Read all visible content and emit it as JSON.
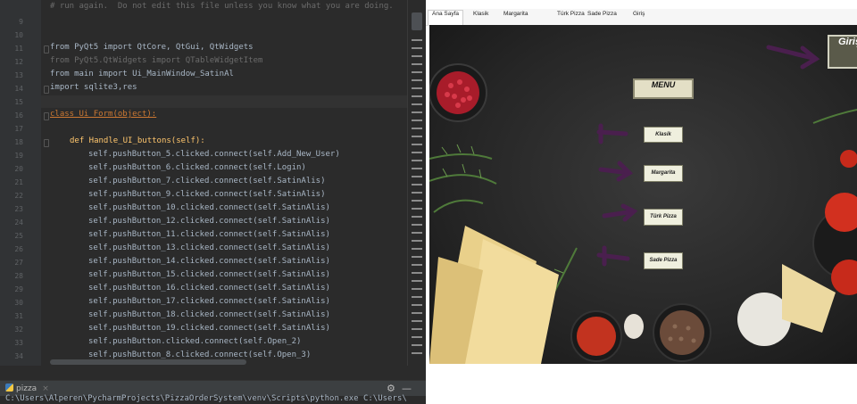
{
  "ide": {
    "top_comment": "# run again.  Do not edit this file unless you know what you are doing.",
    "line_numbers": [
      "9",
      "10",
      "11",
      "12",
      "13",
      "14",
      "15",
      "16",
      "17",
      "18",
      "19",
      "20",
      "21",
      "22",
      "23",
      "24",
      "25",
      "26",
      "27",
      "28",
      "29",
      "30",
      "31",
      "32",
      "33",
      "34"
    ],
    "lines": {
      "import1": "from PyQt5 import QtCore, QtGui, QtWidgets",
      "import2": "from PyQt5.QtWidgets import QTableWidgetItem",
      "import3": "from main import Ui_MainWindow_SatinAl",
      "import4": "import sqlite3,res",
      "class_def": "class Ui_Form(object):",
      "method_def": "def Handle_UI_buttons(self):",
      "c1": "self.pushButton_5.clicked.connect(self.Add_New_User)",
      "c2": "self.pushButton_6.clicked.connect(self.Login)",
      "c3": "self.pushButton_7.clicked.connect(self.SatinAlis)",
      "c4": "self.pushButton_9.clicked.connect(self.SatinAlis)",
      "c5": "self.pushButton_10.clicked.connect(self.SatinAlis)",
      "c6": "self.pushButton_12.clicked.connect(self.SatinAlis)",
      "c7": "self.pushButton_11.clicked.connect(self.SatinAlis)",
      "c8": "self.pushButton_13.clicked.connect(self.SatinAlis)",
      "c9": "self.pushButton_14.clicked.connect(self.SatinAlis)",
      "c10": "self.pushButton_15.clicked.connect(self.SatinAlis)",
      "c11": "self.pushButton_16.clicked.connect(self.SatinAlis)",
      "c12": "self.pushButton_17.clicked.connect(self.SatinAlis)",
      "c13": "self.pushButton_18.clicked.connect(self.SatinAlis)",
      "c14": "self.pushButton_19.clicked.connect(self.SatinAlis)",
      "c15": "self.pushButton.clicked.connect(self.Open_2)",
      "c16": "self.pushButton_8.clicked.connect(self.Open_3)"
    },
    "run_tab": "pizza",
    "run_path": "C:\\Users\\Alperen\\PycharmProjects\\PizzaOrderSystem\\venv\\Scripts\\python.exe C:\\Users\\"
  },
  "app": {
    "tabs": [
      "Ana Sayfa",
      "Klasik",
      "Margarita",
      "Türk Pizza",
      "Sade Pizza",
      "Giriş"
    ],
    "active_tab": "Ana Sayfa",
    "menu_title": "MENU",
    "buttons": {
      "klasik": "Klasik",
      "margarita": "Margarita",
      "turk": "Türk Pizza",
      "sade": "Sade Pizza",
      "giris": "Giriş"
    },
    "arrow_color": "#4a1f4e"
  }
}
